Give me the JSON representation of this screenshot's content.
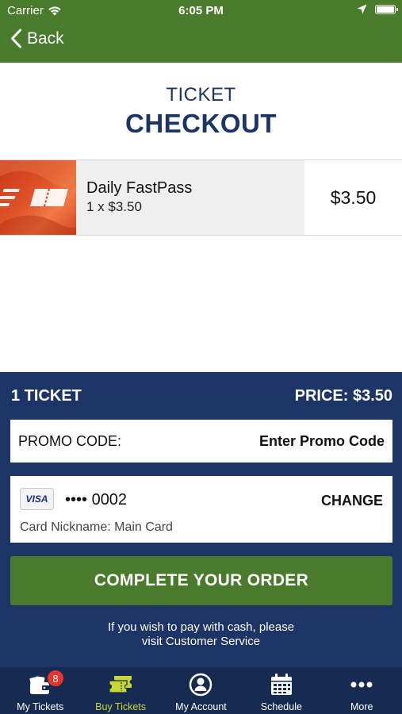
{
  "status_bar": {
    "carrier": "Carrier",
    "time": "6:05 PM"
  },
  "nav": {
    "back_label": "Back"
  },
  "title": {
    "line1": "TICKET",
    "line2": "CHECKOUT"
  },
  "ticket": {
    "name": "Daily FastPass",
    "quantity_text": "1 x $3.50",
    "price": "$3.50"
  },
  "order": {
    "ticket_count": "1 TICKET",
    "price_label": "PRICE: $3.50",
    "promo": {
      "label": "PROMO CODE:",
      "action": "Enter Promo Code"
    },
    "card": {
      "brand": "VISA",
      "number": "•••• 0002",
      "change_label": "CHANGE",
      "nickname": "Card Nickname: Main Card"
    },
    "complete_label": "COMPLETE YOUR ORDER",
    "cash_note_line1": "If you wish to pay with cash, please",
    "cash_note_line2": "visit Customer Service"
  },
  "tabs": [
    {
      "label": "My Tickets",
      "icon": "wallet-icon",
      "badge": "8",
      "active": false
    },
    {
      "label": "Buy Tickets",
      "icon": "tickets-icon",
      "active": true
    },
    {
      "label": "My Account",
      "icon": "account-icon",
      "active": false
    },
    {
      "label": "Schedule",
      "icon": "calendar-icon",
      "active": false
    },
    {
      "label": "More",
      "icon": "more-icon",
      "active": false
    }
  ],
  "colors": {
    "header_green": "#4a7a2c",
    "navy": "#1c3566",
    "tab_bar": "#172a52",
    "active_tab": "#c9d735",
    "badge_red": "#e8352b"
  }
}
